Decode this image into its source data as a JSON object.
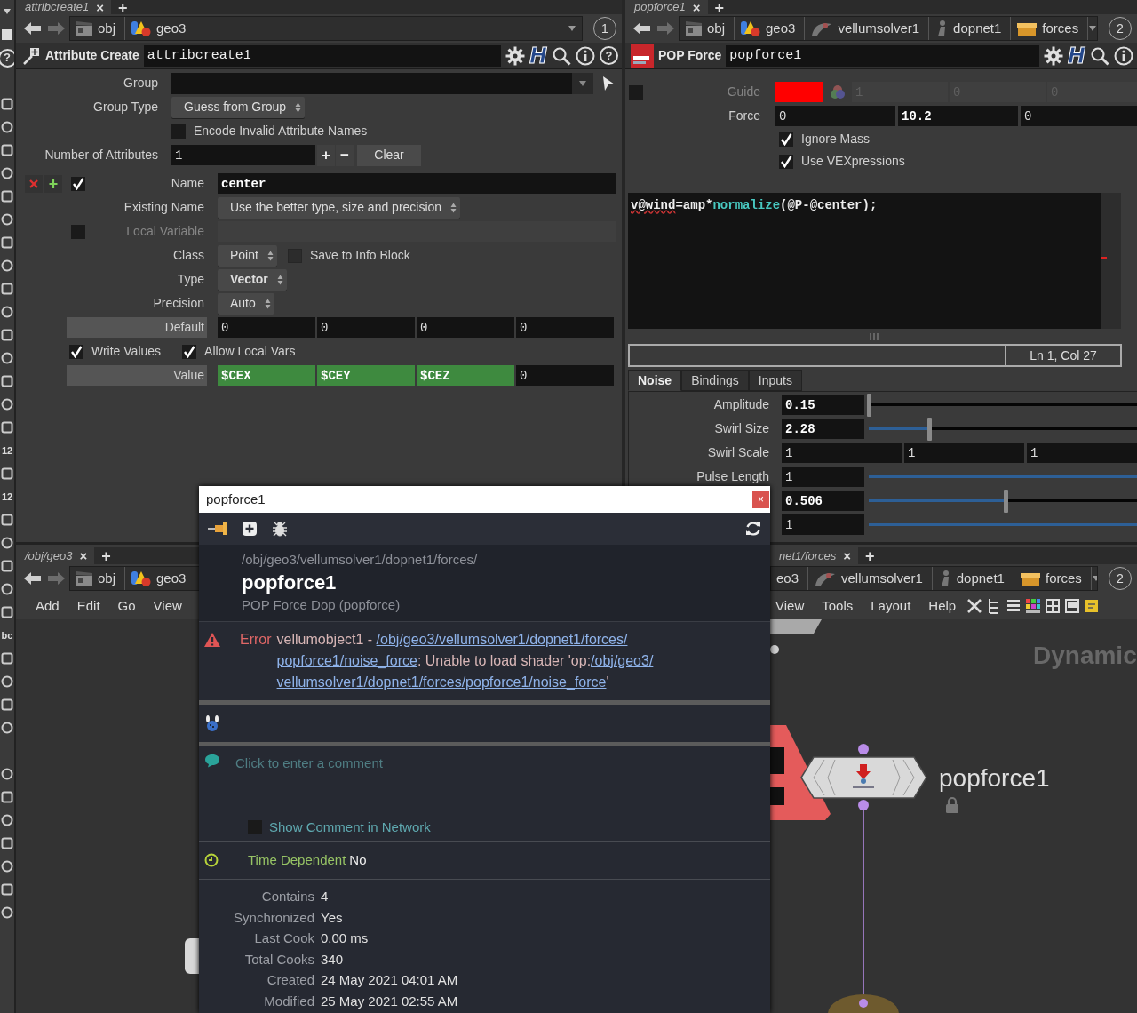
{
  "left_toolbar": {
    "help": "?",
    "labels": [
      "12",
      "12",
      "bc"
    ]
  },
  "attrib_pane": {
    "tab": {
      "label": "attribcreate1",
      "close": "×",
      "add": "+"
    },
    "path": [
      {
        "label": "obj",
        "kind": "object"
      },
      {
        "label": "geo3",
        "kind": "geometry"
      }
    ],
    "desk": "1",
    "header": {
      "type": "Attribute Create",
      "name": "attribcreate1",
      "help_mark": "H",
      "question": "?"
    },
    "params": [
      {
        "kind": "group",
        "label": "Group"
      },
      {
        "kind": "menu",
        "label": "Group Type",
        "value": "Guess from Group",
        "modified": false
      },
      {
        "kind": "toggle",
        "label": "Encode Invalid Attribute Names",
        "checked": false
      },
      {
        "kind": "multiparm",
        "label": "Number of Attributes",
        "value": "1",
        "plus": "+",
        "minus": "−",
        "button": "Clear"
      }
    ],
    "instance": {
      "enabled": true,
      "params": [
        {
          "kind": "field",
          "label": "Name",
          "value": "center",
          "modified": true,
          "disabled": false
        },
        {
          "kind": "menu",
          "label": "Existing Name",
          "value": "Use the better type, size and precision",
          "modified": false
        },
        {
          "kind": "field",
          "label": "Local Variable",
          "disabled": true,
          "checked": false
        },
        {
          "kind": "menu",
          "label": "Class",
          "value": "Point",
          "modified": false,
          "extra": {
            "label": "Save to Info Block",
            "checked": false,
            "disabled": true
          }
        },
        {
          "kind": "menu",
          "label": "Type",
          "value": "Vector",
          "modified": true
        },
        {
          "kind": "menu",
          "label": "Precision",
          "value": "Auto",
          "modified": false
        },
        {
          "kind": "vector",
          "label": "Default",
          "boxed": true,
          "values": [
            {
              "text": "0",
              "modified": false,
              "expression": false
            },
            {
              "text": "0",
              "modified": false,
              "expression": false
            },
            {
              "text": "0",
              "modified": false,
              "expression": false
            },
            {
              "text": "0",
              "modified": false,
              "expression": false
            }
          ]
        },
        {
          "kind": "toggles",
          "items": [
            {
              "label": "Write Values",
              "checked": true
            },
            {
              "label": "Allow Local Vars",
              "checked": true
            }
          ]
        },
        {
          "kind": "vector",
          "label": "Value",
          "boxed": true,
          "values": [
            {
              "text": "$CEX",
              "modified": true,
              "expression": true
            },
            {
              "text": "$CEY",
              "modified": true,
              "expression": true
            },
            {
              "text": "$CEZ",
              "modified": true,
              "expression": true
            },
            {
              "text": "0",
              "modified": false,
              "expression": false
            }
          ]
        }
      ]
    }
  },
  "force_pane": {
    "tab": {
      "label": "popforce1",
      "close": "×",
      "add": "+"
    },
    "path": [
      {
        "label": "obj",
        "kind": "object"
      },
      {
        "label": "geo3",
        "kind": "geometry"
      },
      {
        "label": "vellumsolver1",
        "kind": "solver"
      },
      {
        "label": "dopnet1",
        "kind": "dopnet"
      },
      {
        "label": "forces",
        "kind": "subnet"
      }
    ],
    "desk": "2",
    "header": {
      "type": "POP Force",
      "name": "popforce1",
      "help_mark": "H"
    },
    "params": [
      {
        "kind": "guide",
        "label": "Guide",
        "checked": false,
        "color": "#ff0000",
        "values": [
          "1",
          "0",
          "0"
        ]
      },
      {
        "kind": "vector",
        "label": "Force",
        "values": [
          {
            "text": "0",
            "modified": false
          },
          {
            "text": "10.2",
            "modified": true
          },
          {
            "text": "0",
            "modified": false
          }
        ]
      },
      {
        "kind": "toggle",
        "label": "Ignore Mass",
        "checked": true
      },
      {
        "kind": "toggle",
        "label": "Use VEXpressions",
        "checked": true
      }
    ],
    "code": [
      {
        "text": "v@wind",
        "kind": "flagged"
      },
      {
        "text": "=amp*",
        "kind": "plain"
      },
      {
        "text": "normalize",
        "kind": "function"
      },
      {
        "text": "(@P-@center);",
        "kind": "plain"
      }
    ],
    "cursor": "Ln 1, Col 27",
    "tabs": [
      {
        "label": "Noise",
        "selected": true
      },
      {
        "label": "Bindings",
        "selected": false
      },
      {
        "label": "Inputs",
        "selected": false
      }
    ],
    "noise": [
      {
        "kind": "slider",
        "label": "Amplitude",
        "value": "0.15",
        "modified": true,
        "level": 0.0
      },
      {
        "kind": "slider",
        "label": "Swirl Size",
        "value": "2.28",
        "modified": true,
        "level": 0.17
      },
      {
        "kind": "vector",
        "label": "Swirl Scale",
        "values": [
          {
            "text": "1",
            "modified": false
          },
          {
            "text": "1",
            "modified": false
          },
          {
            "text": "1",
            "modified": false
          }
        ]
      },
      {
        "kind": "slider",
        "label": "Pulse Length",
        "value": "1",
        "modified": false,
        "level": 1
      },
      {
        "kind": "slider",
        "value": "0.506",
        "modified": true,
        "level": 0.385
      },
      {
        "kind": "slider",
        "value": "1",
        "modified": false,
        "level": 1
      }
    ]
  },
  "geo_pane": {
    "tab": {
      "label": "/obj/geo3",
      "close": "×",
      "add": "+"
    },
    "path": [
      {
        "label": "obj",
        "kind": "object"
      },
      {
        "label": "geo3",
        "kind": "geometry"
      }
    ],
    "menus": [
      "Add",
      "Edit",
      "Go",
      "View"
    ]
  },
  "network_pane": {
    "tab": {
      "label": "net1/forces",
      "close": "×",
      "add": "+"
    },
    "path": [
      {
        "label": "eo3",
        "kind": "text"
      },
      {
        "label": "vellumsolver1",
        "kind": "solver"
      },
      {
        "label": "dopnet1",
        "kind": "dopnet"
      },
      {
        "label": "forces",
        "kind": "subnet"
      }
    ],
    "desk": "2",
    "menus": [
      "View",
      "Tools",
      "Layout",
      "Help"
    ],
    "context_label": "Dynamic",
    "node": {
      "name": "popforce1",
      "locked": true
    }
  },
  "info_popup": {
    "title": "popforce1",
    "close": "×",
    "path": "/obj/geo3/vellumsolver1/dopnet1/forces/",
    "name": "popforce1",
    "type": "POP Force Dop (popforce)",
    "error": {
      "label": "Error",
      "segments": [
        {
          "text": "vellumobject1 - ",
          "link": false
        },
        {
          "text": "/obj/geo3/vellumsolver1/dopnet1/forces/",
          "link": true
        },
        {
          "text": "popforce1/noise_force",
          "link": true
        },
        {
          "text": ": Unable to load shader 'op:",
          "link": false
        },
        {
          "text": "/obj/geo3/",
          "link": true
        },
        {
          "text": "vellumsolver1/dopnet1/forces/popforce1/noise_force",
          "link": true
        },
        {
          "text": "'",
          "link": false
        }
      ]
    },
    "comment": {
      "placeholder": "Click to enter a comment",
      "show_in_network": {
        "label": "Show Comment in Network",
        "checked": false
      }
    },
    "time_dependent": {
      "label": "Time Dependent",
      "value": "No"
    },
    "stats": [
      {
        "label": "Contains",
        "value": "4"
      },
      {
        "label": "Synchronized",
        "value": "Yes"
      },
      {
        "label": "Last Cook",
        "value": "0.00 ms"
      },
      {
        "label": "Total Cooks",
        "value": "340"
      },
      {
        "label": "Created",
        "value": "24 May 2021 04:01 AM"
      },
      {
        "label": "Modified",
        "value": "25 May 2021 02:55 AM"
      }
    ]
  }
}
